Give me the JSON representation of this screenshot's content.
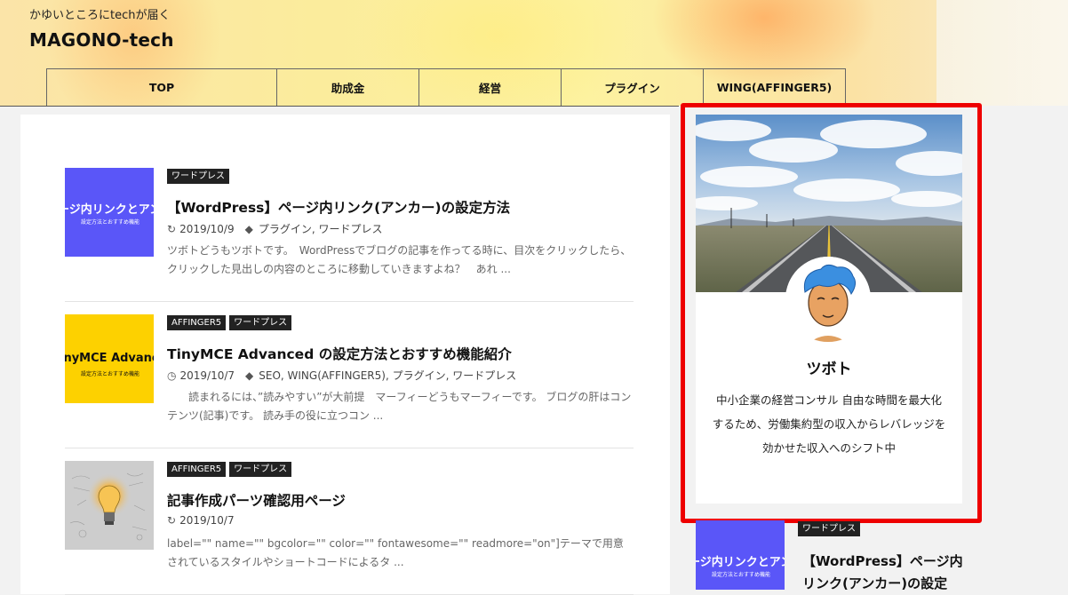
{
  "header": {
    "tagline": "かゆいところにtechが届く",
    "site_title": "MAGONO-tech"
  },
  "nav": [
    "TOP",
    "助成金",
    "経営",
    "プラグイン",
    "WING(AFFINGER5)"
  ],
  "posts": [
    {
      "thumb_text": "ージ内リンクとアン",
      "thumb_sub": "設定方法とおすすめ機能",
      "categories": [
        "ワードプレス"
      ],
      "title": "【WordPress】ページ内リンク(アンカー)の設定方法",
      "date": "2019/10/9",
      "tags": "プラグイン, ワードプレス",
      "excerpt": "ツボトどうもツボトです。　WordPressでブログの記事を作ってる時に、目次をクリックしたら、クリックした見出しの内容のところに移動していきますよね？　あれ ..."
    },
    {
      "thumb_text": "inyMCE Advanced",
      "thumb_sub": "設定方法とおすすめ機能",
      "categories": [
        "AFFINGER5",
        "ワードプレス"
      ],
      "title": "TinyMCE Advanced の設定方法とおすすめ機能紹介",
      "date": "2019/10/7",
      "tags": "SEO, WING(AFFINGER5), プラグイン, ワードプレス",
      "excerpt": "読まれるには、”読みやすい”が大前提　マーフィーどうもマーフィーです。 ブログの肝はコンテンツ(記事)です。 読み手の役に立つコン ..."
    },
    {
      "thumb_text": "",
      "thumb_sub": "",
      "categories": [
        "AFFINGER5",
        "ワードプレス"
      ],
      "title": "記事作成パーツ確認用ページ",
      "date": "2019/10/7",
      "tags": "",
      "excerpt": "label=\"\" name=\"\" bgcolor=\"\" color=\"\" fontawesome=\"\" readmore=\"on\"]テーマで用意されているスタイルやショートコードによるタ ..."
    }
  ],
  "profile": {
    "name": "ツボト",
    "bio": "中小企業の経営コンサル 自由な時間を最大化するため、労働集約型の収入からレバレッジを効かせた収入へのシフト中"
  },
  "sidebar_post": {
    "thumb_text": "ージ内リンクとアン",
    "thumb_sub": "設定方法とおすすめ機能",
    "category": "ワードプレス",
    "title": "【WordPress】ページ内リンク(アンカー)の設定"
  },
  "colors": {
    "highlight_border": "#e00000",
    "category_badge": "#222222",
    "thumb_purple": "#5a56f8",
    "thumb_yellow": "#fdd100"
  }
}
